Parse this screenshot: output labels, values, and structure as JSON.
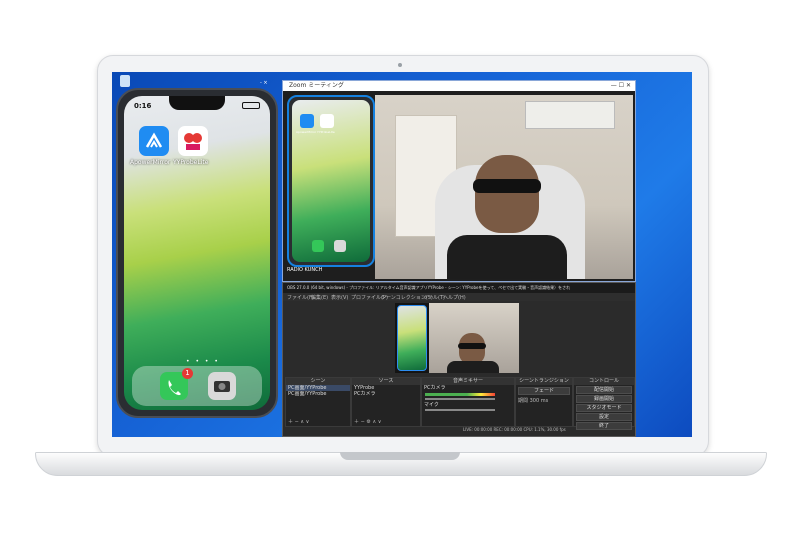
{
  "phone": {
    "time": "0:16",
    "apps": [
      {
        "label": "ApowerMirror",
        "icon": "apowermirror-icon"
      },
      {
        "label": "YYProbeLite",
        "icon": "yyprobelite-icon"
      }
    ],
    "dots": "• • • •",
    "dock_badge": "1"
  },
  "zoom_window": {
    "title": "Zoom ミーティング",
    "label": "RADIO KUNCH",
    "preview_apps": [
      "ApowerMirror",
      "YYProbeLite"
    ]
  },
  "obs_window": {
    "title": "OBS 27.0.0 (64 bit, windows) - プロファイル: リアルタイム音声認識アプリYYProbe - シーン: YYProbeを使って、ペセで出て実験・音声認識結果）をされ",
    "menu": [
      "ファイル(F)",
      "編集(E)",
      "表示(V)",
      "プロファイル(P)",
      "シーンコレクション(S)",
      "ツール(T)",
      "ヘルプ(H)"
    ],
    "docks": {
      "scenes": {
        "title": "シーン",
        "items": [
          "PC画面/YYProbe",
          "PC画面/YYProbe"
        ]
      },
      "sources": {
        "title": "ソース",
        "items": [
          "YYProbe",
          "PCカメラ"
        ]
      },
      "mixer": {
        "title": "音声ミキサー",
        "items": [
          "PCカメラ",
          "マイク"
        ]
      },
      "transitions": {
        "title": "シーントランジション",
        "fade": "フェード",
        "duration_label": "期間",
        "duration": "300 ms"
      },
      "controls": {
        "title": "コントロール",
        "buttons": [
          "配信開始",
          "録画開始",
          "スタジオモード",
          "設定",
          "終了"
        ]
      }
    },
    "status": "LIVE: 00:00:00   REC: 00:00:00   CPU: 1.1%, 30.00 fps"
  }
}
